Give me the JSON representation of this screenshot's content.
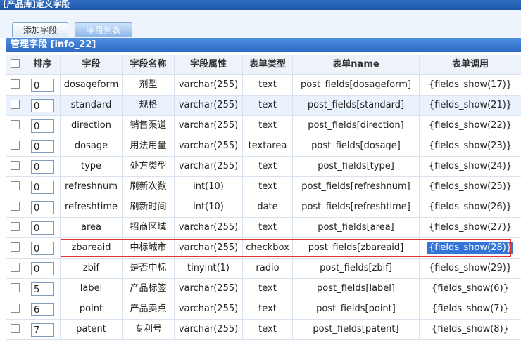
{
  "window": {
    "title": "[产品库]定义字段"
  },
  "tabs": [
    {
      "label": "添加字段",
      "active": false
    },
    {
      "label": "字段列表",
      "active": true
    }
  ],
  "section": {
    "title": "管理字段 [info_22]"
  },
  "columns": [
    "排序",
    "字段",
    "字段名称",
    "字段属性",
    "表单类型",
    "表单name",
    "表单调用"
  ],
  "rows": [
    {
      "sort": "0",
      "field": "dosageform",
      "name": "剂型",
      "attr": "varchar(255)",
      "type": "text",
      "form_name": "post_fields[dosageform]",
      "call": "{fields_show(17)}"
    },
    {
      "sort": "0",
      "field": "standard",
      "name": "规格",
      "attr": "varchar(255)",
      "type": "text",
      "form_name": "post_fields[standard]",
      "call": "{fields_show(21)}"
    },
    {
      "sort": "0",
      "field": "direction",
      "name": "销售渠道",
      "attr": "varchar(255)",
      "type": "text",
      "form_name": "post_fields[direction]",
      "call": "{fields_show(22)}"
    },
    {
      "sort": "0",
      "field": "dosage",
      "name": "用法用量",
      "attr": "varchar(255)",
      "type": "textarea",
      "form_name": "post_fields[dosage]",
      "call": "{fields_show(23)}"
    },
    {
      "sort": "0",
      "field": "type",
      "name": "处方类型",
      "attr": "varchar(255)",
      "type": "text",
      "form_name": "post_fields[type]",
      "call": "{fields_show(24)}"
    },
    {
      "sort": "0",
      "field": "refreshnum",
      "name": "刷新次数",
      "attr": "int(10)",
      "type": "text",
      "form_name": "post_fields[refreshnum]",
      "call": "{fields_show(25)}"
    },
    {
      "sort": "0",
      "field": "refreshtime",
      "name": "刷新时间",
      "attr": "int(10)",
      "type": "date",
      "form_name": "post_fields[refreshtime]",
      "call": "{fields_show(26)}"
    },
    {
      "sort": "0",
      "field": "area",
      "name": "招商区域",
      "attr": "varchar(255)",
      "type": "text",
      "form_name": "post_fields[area]",
      "call": "{fields_show(27)}"
    },
    {
      "sort": "0",
      "field": "zbareaid",
      "name": "中标城市",
      "attr": "varchar(255)",
      "type": "checkbox",
      "form_name": "post_fields[zbareaid]",
      "call": "{fields_show(28)}"
    },
    {
      "sort": "0",
      "field": "zbif",
      "name": "是否中标",
      "attr": "tinyint(1)",
      "type": "radio",
      "form_name": "post_fields[zbif]",
      "call": "{fields_show(29)}"
    },
    {
      "sort": "5",
      "field": "label",
      "name": "产品标签",
      "attr": "varchar(255)",
      "type": "text",
      "form_name": "post_fields[label]",
      "call": "{fields_show(6)}"
    },
    {
      "sort": "6",
      "field": "point",
      "name": "产品卖点",
      "attr": "varchar(255)",
      "type": "text",
      "form_name": "post_fields[point]",
      "call": "{fields_show(7)}"
    },
    {
      "sort": "7",
      "field": "patent",
      "name": "专利号",
      "attr": "varchar(255)",
      "type": "text",
      "form_name": "post_fields[patent]",
      "call": "{fields_show(8)}"
    }
  ]
}
